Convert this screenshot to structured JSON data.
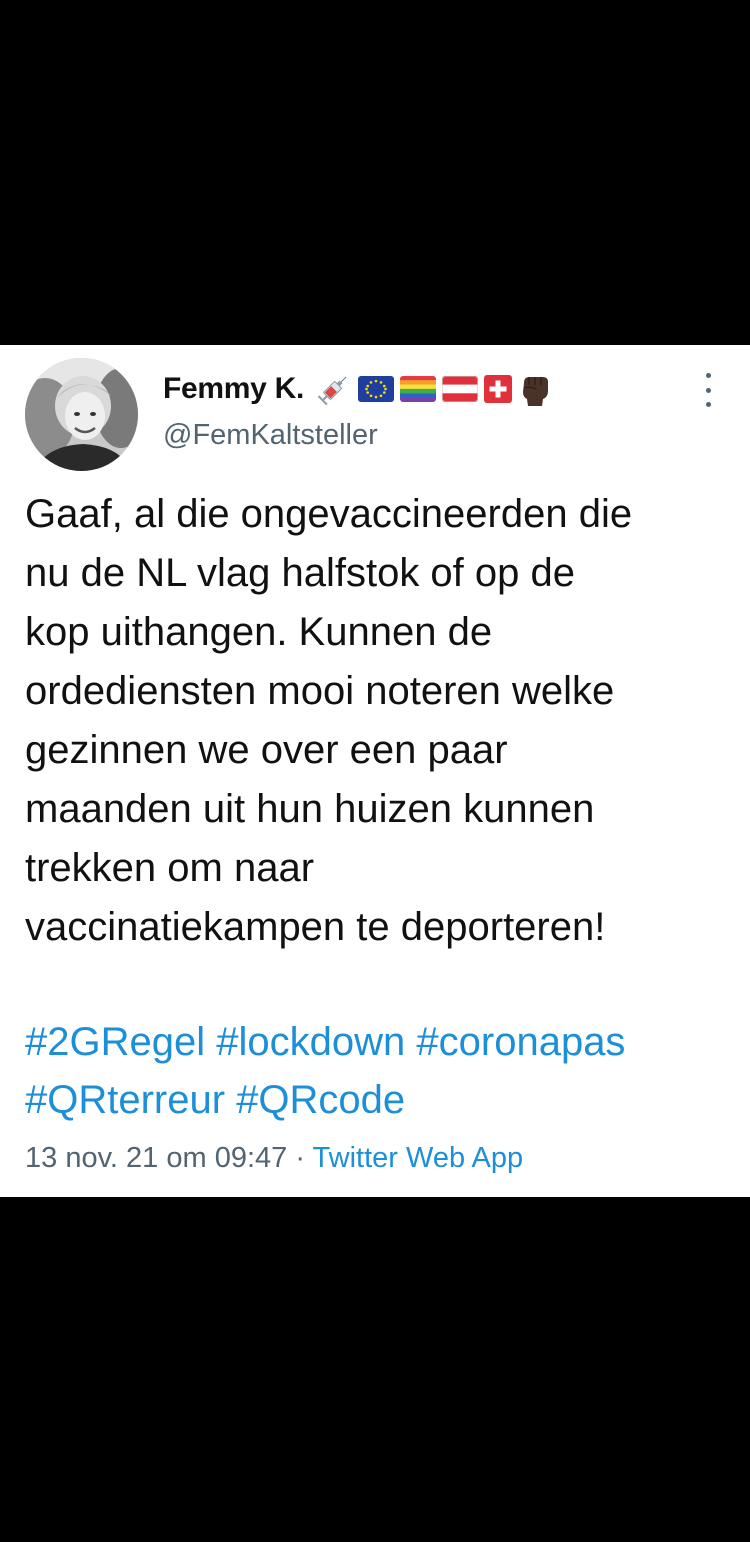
{
  "tweet": {
    "display_name": "Femmy K.",
    "handle": "@FemKaltsteller",
    "name_emojis": [
      "syringe-emoji",
      "eu-flag-emoji",
      "rainbow-flag-emoji",
      "austria-flag-emoji",
      "switzerland-flag-emoji",
      "raised-fist-emoji"
    ],
    "text_lines": [
      "Gaaf, al die ongevaccineerden die",
      "nu de NL vlag halfstok of op de",
      "kop uithangen. Kunnen de",
      "ordediensten mooi noteren welke",
      "gezinnen we over een paar",
      "maanden uit hun huizen kunnen",
      "trekken om naar",
      "vaccinatiekampen te deporteren!"
    ],
    "hashtags_row1": [
      "#2GRegel",
      "#lockdown",
      "#coronapas"
    ],
    "hashtags_row2": [
      "#QRterreur",
      "#QRcode"
    ],
    "timestamp": "13 nov. 21 om 09:47",
    "separator": " · ",
    "source": "Twitter Web App"
  },
  "colors": {
    "background": "#000000",
    "card": "#ffffff",
    "text": "#111111",
    "secondary_text": "#536471",
    "link": "#1d8fd8"
  }
}
